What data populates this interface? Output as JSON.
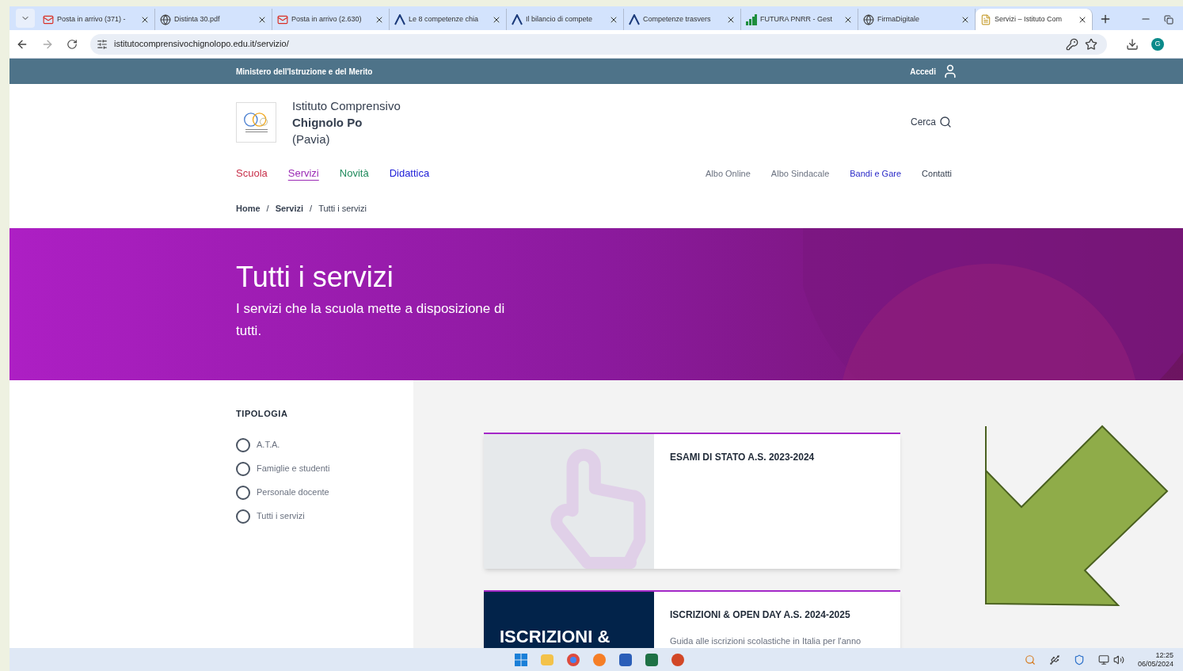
{
  "browser": {
    "tabs": [
      {
        "title": "Posta in arrivo (371) -",
        "kind": "mail",
        "selected": false
      },
      {
        "title": "Distinta 30.pdf",
        "kind": "globe",
        "selected": false
      },
      {
        "title": "Posta in arrivo (2.630)",
        "kind": "mail",
        "selected": false
      },
      {
        "title": "Le 8 competenze chia",
        "kind": "lambda",
        "selected": false
      },
      {
        "title": "Il bilancio di compete",
        "kind": "lambda",
        "selected": false
      },
      {
        "title": "Competenze trasvers",
        "kind": "lambda",
        "selected": false
      },
      {
        "title": "FUTURA PNRR - Gest",
        "kind": "bars",
        "selected": false
      },
      {
        "title": "FirmaDigitale",
        "kind": "globe",
        "selected": false
      },
      {
        "title": "Servizi – Istituto Com",
        "kind": "page",
        "selected": true
      }
    ],
    "url": "istitutocomprensivochignolopo.edu.it/servizio/",
    "profile": "G"
  },
  "top_bar": {
    "ministry": "Ministero dell'Istruzione e del Merito",
    "login": "Accedi"
  },
  "header": {
    "line_1": "Istituto Comprensivo",
    "line_2": "Chignolo Po",
    "line_3": "(Pavia)",
    "search": "Cerca"
  },
  "main_nav": [
    {
      "label": "Scuola",
      "color": "#c8304a",
      "selected": false
    },
    {
      "label": "Servizi",
      "color": "#9b2bb5",
      "selected": true
    },
    {
      "label": "Novità",
      "color": "#1f8a5c",
      "selected": false
    },
    {
      "label": "Didattica",
      "color": "#2020d8",
      "selected": false
    }
  ],
  "secondary_nav": [
    {
      "label": "Albo Online",
      "color": "#6b7280"
    },
    {
      "label": "Albo Sindacale",
      "color": "#6b7280"
    },
    {
      "label": "Bandi e Gare",
      "color": "#2a2ac8"
    },
    {
      "label": "Contatti",
      "color": "#374151"
    }
  ],
  "breadcrumb": {
    "separator": "/",
    "items": [
      "Home",
      "Servizi",
      "Tutti i servizi"
    ]
  },
  "hero": {
    "title": "Tutti i servizi",
    "subtitle": "I servizi che la scuola mette a disposizione di tutti."
  },
  "filter": {
    "heading": "TIPOLOGIA",
    "options": [
      {
        "label": "A.T.A.",
        "selected": false
      },
      {
        "label": "Famiglie e studenti",
        "selected": false
      },
      {
        "label": "Personale docente",
        "selected": false
      },
      {
        "label": "Tutti i servizi",
        "selected": false
      }
    ]
  },
  "cards": [
    {
      "kind": "hand",
      "title": "ESAMI DI STATO A.S. 2023-2024"
    },
    {
      "kind": "banner",
      "title": "ISCRIZIONI & OPEN DAY A.S. 2024-2025",
      "image_text": "ISCRIZIONI &",
      "text": "Guida alle iscrizioni scolastiche in Italia per l'anno"
    }
  ],
  "taskbar": {
    "time": "12:25",
    "date": "06/05/2024"
  }
}
